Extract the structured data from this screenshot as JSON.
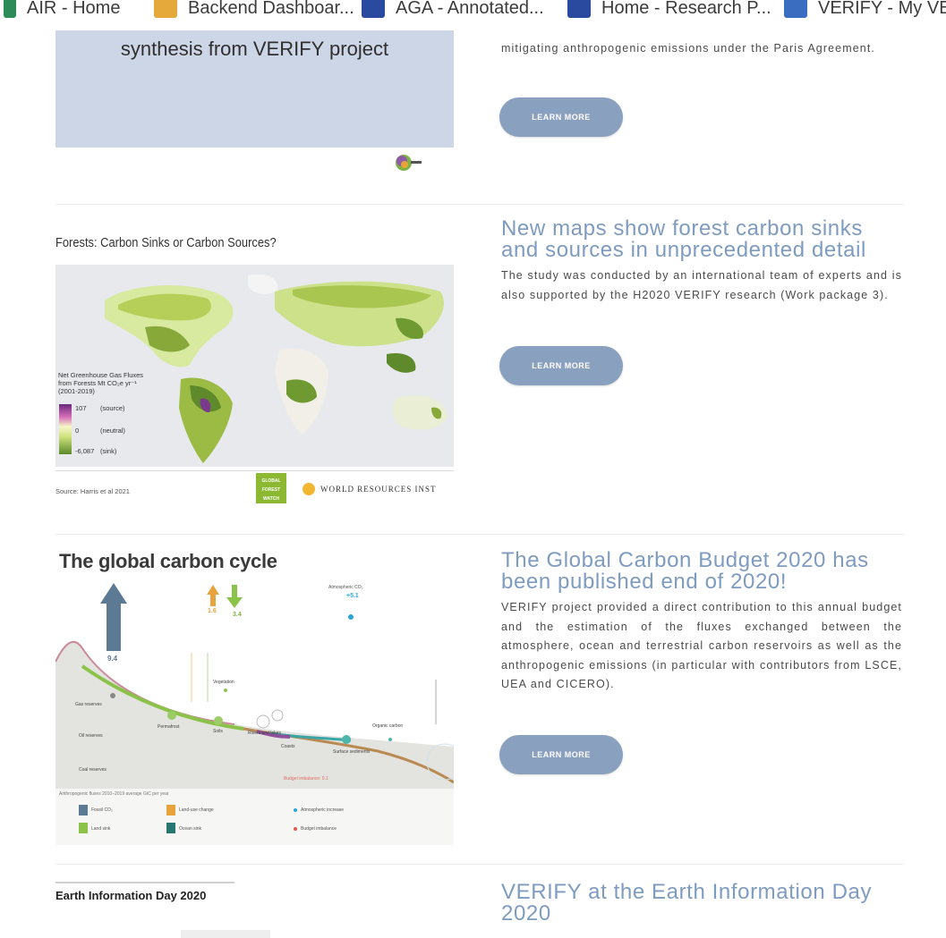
{
  "bookmarks": [
    {
      "label": "AIR - Home",
      "icon": "green-flag-icon",
      "color": "#2e8b57"
    },
    {
      "label": "Backend Dashboar...",
      "icon": "dashboard-icon",
      "color": "#e5a93b"
    },
    {
      "label": "AGA - Annotated...",
      "icon": "eu-flag-icon",
      "color": "#2a4aa0"
    },
    {
      "label": "Home - Research P...",
      "icon": "eu-flag-icon",
      "color": "#2a4aa0"
    },
    {
      "label": "VERIFY - My VER",
      "icon": "verify-logo-icon",
      "color": "#3a6cc0"
    }
  ],
  "items": [
    {
      "image_caption": "synthesis from VERIFY project",
      "summary": "mitigating anthropogenic emissions under the Paris Agreement.",
      "button_label": "LEARN MORE"
    },
    {
      "title": "New maps show forest carbon sinks and sources in unprecedented detail",
      "summary": "The study was conducted by an international team of experts and is also supported by the H2020 VERIFY research (Work package 3).",
      "button_label": "LEARN MORE",
      "image": {
        "heading": "Forests: Carbon Sinks or Carbon Sources?",
        "legend_title": "Net Greenhouse Gas Fluxes from Forests Mt CO₂e yr⁻¹ (2001-2019)",
        "legend_source_value": "107",
        "legend_source_label": "(source)",
        "legend_neutral_value": "0",
        "legend_neutral_label": "(neutral)",
        "legend_sink_value": "-6,087",
        "legend_sink_label": "(sink)",
        "source_note": "Source: Harris et al 2021",
        "gfw_logo": "GLOBAL FOREST WATCH",
        "wri_logo": "WORLD RESOURCES INST"
      }
    },
    {
      "title": "The Global Carbon Budget 2020 has been published end of 2020!",
      "summary": "VERIFY project provided a direct contribution to this annual budget and the estimation of the fluxes exchanged between the atmosphere, ocean and terrestrial carbon reservoirs as well as the anthropogenic emissions (in particular with contributors from LSCE, UEA and CICERO).",
      "button_label": "LEARN MORE",
      "image": {
        "heading": "The global carbon cycle",
        "fossil_value": "9.4",
        "landuse_value": "1.6",
        "land_sink_value": "3.4",
        "atm_label": "Atmospheric CO₂",
        "atm_value": "+5.1",
        "labels": [
          "Vegetation",
          "Permafrost",
          "Soils",
          "Rivers and lakes",
          "Coasts",
          "Surface sediments",
          "Organic carbon"
        ],
        "reserves": [
          "Gas reserves",
          "Oil reserves",
          "Coal reserves"
        ],
        "budget_imbalance": "Budget imbalance: 0.1",
        "footer_note": "Anthropogenic fluxes 2010–2019 average GtC per year",
        "legend": [
          "Fossil CO₂",
          "Land-use change",
          "Land sink",
          "Ocean sink",
          "Atmospheric increase",
          "Budget imbalance"
        ]
      }
    },
    {
      "title": "VERIFY at the Earth Information Day 2020",
      "image": {
        "heading": "Earth Information Day 2020"
      }
    }
  ]
}
